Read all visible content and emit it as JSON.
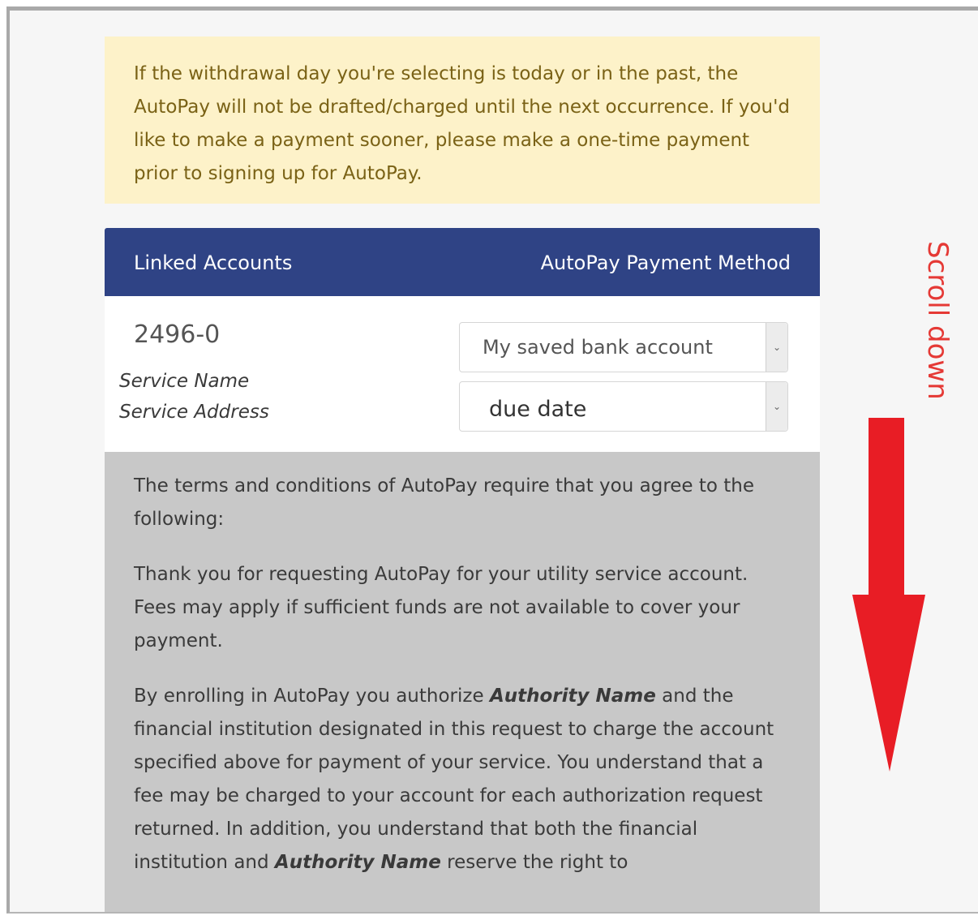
{
  "notice": {
    "text": "If the withdrawal day you're selecting is today or in the past, the AutoPay will not be drafted/charged until the next occurrence. If you'd like to make a payment sooner, please make a one-time payment prior to signing up for AutoPay."
  },
  "table": {
    "header_left": "Linked Accounts",
    "header_right": "AutoPay Payment Method",
    "account_number": "2496-0",
    "service_name": "Service Name",
    "service_address": "Service Address",
    "payment_method_selected": "My saved bank account",
    "draft_day_selected": "due date"
  },
  "terms": {
    "intro": "The terms and conditions of AutoPay require that you agree to the following:",
    "thanks": "Thank you for requesting AutoPay for your utility service account. Fees may apply if sufficient funds are not available to cover your payment.",
    "auth_part1": "By enrolling in AutoPay you authorize ",
    "authority_name_1": "Authority Name",
    "auth_part2": " and the financial institution designated in this request to charge the account specified above for payment of your service. You understand that a fee may be charged to your account for each authorization request returned. In addition, you understand that both the financial institution and ",
    "authority_name_2": "Authority Name",
    "auth_part3": " reserve the right to"
  },
  "annotation": {
    "scroll_text": "Scroll down",
    "color": "#e53935"
  },
  "colors": {
    "header_bg": "#2f4385",
    "notice_bg": "#fdf2c9",
    "terms_bg": "#c8c8c8"
  }
}
